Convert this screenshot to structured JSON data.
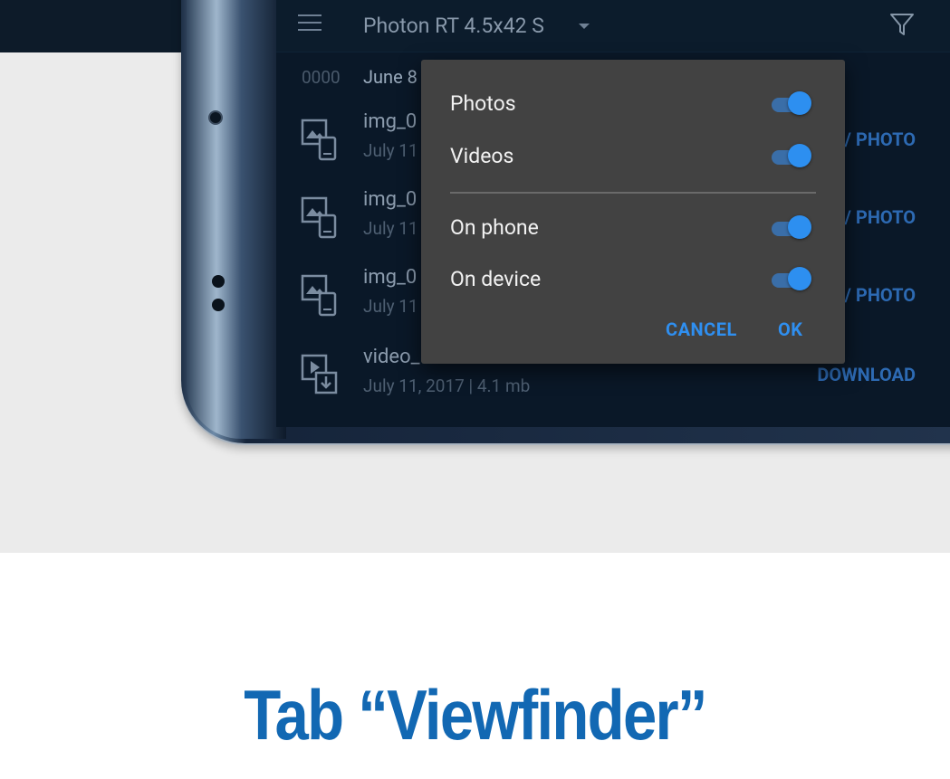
{
  "toolbar": {
    "title": "Photon RT 4.5x42 S",
    "menu_icon": "hamburger-menu-icon",
    "filter_icon": "filter-funnel-icon"
  },
  "date_row": {
    "code": "0000",
    "date": "June 8"
  },
  "rows": [
    {
      "name": "img_0",
      "meta": "July 11",
      "action": "/ PHOTO",
      "icon": "image-on-phone-icon"
    },
    {
      "name": "img_0",
      "meta": "July 11",
      "action": "/ PHOTO",
      "icon": "image-on-phone-icon"
    },
    {
      "name": "img_0",
      "meta": "July 11",
      "action": "/ PHOTO",
      "icon": "image-on-phone-icon"
    },
    {
      "name": "video_",
      "meta": "July 11, 2017 | 4.1 mb",
      "action": "DOWNLOAD",
      "icon": "video-download-icon"
    }
  ],
  "dialog": {
    "options": [
      {
        "label": "Photos",
        "on": true
      },
      {
        "label": "Videos",
        "on": true
      },
      {
        "label": "On phone",
        "on": true
      },
      {
        "label": "On device",
        "on": true
      }
    ],
    "cancel_label": "CANCEL",
    "ok_label": "OK"
  },
  "caption": "Tab “Viewfinder”",
  "colors": {
    "accent": "#2f8ff0",
    "caption": "#1268b3",
    "dialog_bg": "#424242",
    "screen_bg": "#0a1828"
  }
}
